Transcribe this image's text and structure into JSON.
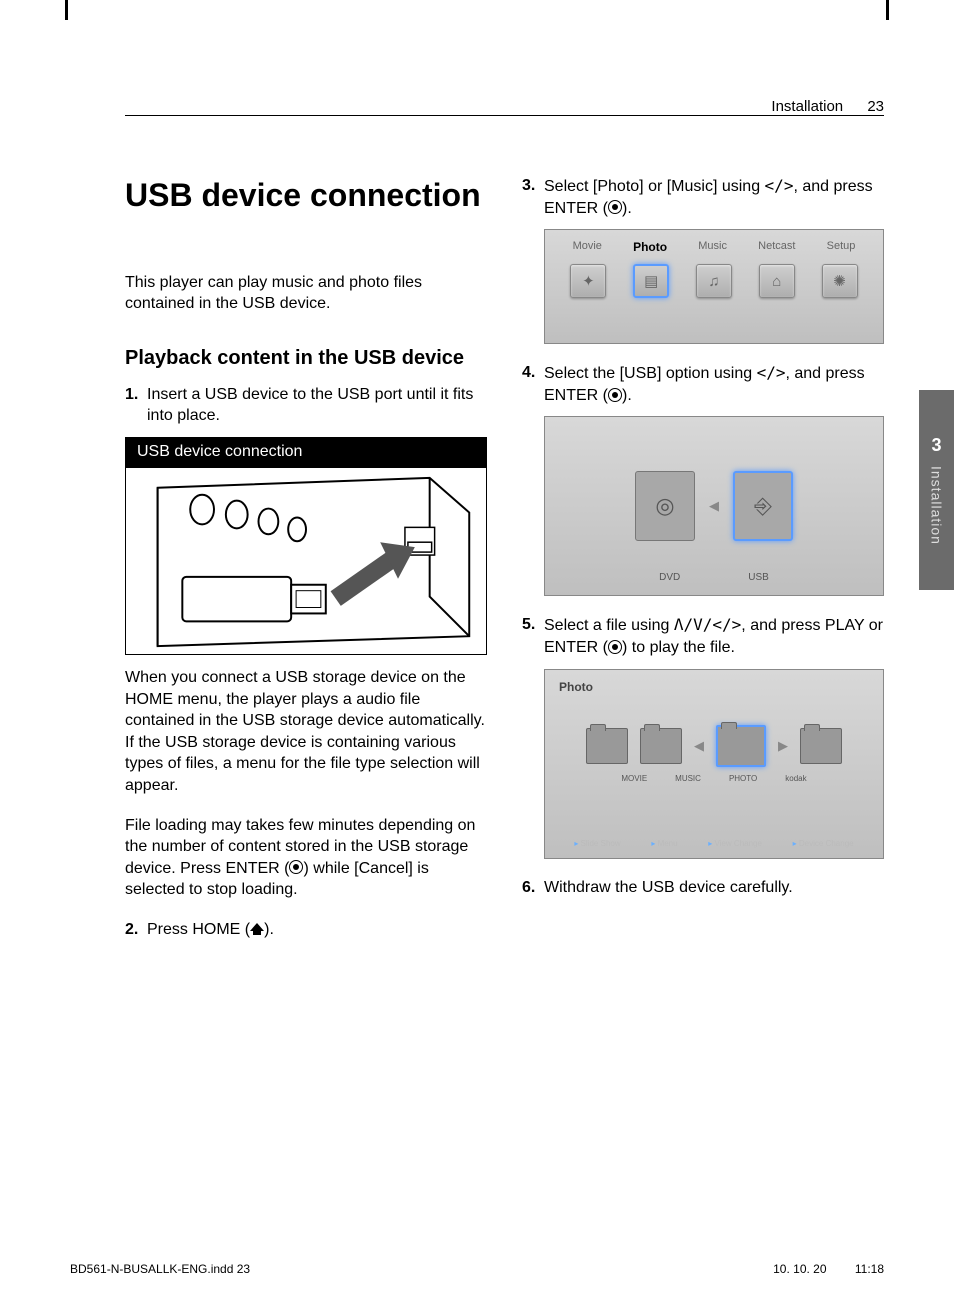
{
  "header": {
    "section": "Installation",
    "page": "23"
  },
  "side": {
    "chapter": "3",
    "label": "Installation"
  },
  "title": "USB device connection",
  "intro": "This player can play music and photo files contained in the USB device.",
  "subheading": "Playback content in the USB device",
  "steps": {
    "s1": {
      "n": "1.",
      "t": "Insert a USB device to the USB port until it fits into place."
    },
    "s2": {
      "n": "2.",
      "pre": "Press HOME (",
      "post": ")."
    },
    "s3": {
      "n": "3.",
      "pre": "Select [Photo] or [Music] using ",
      "nav": "</>",
      "mid": ", and press ENTER (",
      "post": ")."
    },
    "s4": {
      "n": "4.",
      "pre": "Select the [USB] option using ",
      "nav": "</>",
      "mid": ", and press ENTER (",
      "post": ")."
    },
    "s5": {
      "n": "5.",
      "pre": "Select a file using ",
      "nav": "Λ/V/</>",
      "mid": ", and press PLAY or ENTER (",
      "post": ") to play the file."
    },
    "s6": {
      "n": "6.",
      "t": "Withdraw the USB device carefully."
    }
  },
  "diagram_caption": "USB device connection",
  "para1": "When you connect a USB storage device on the HOME menu, the player plays a audio file contained in the USB storage device automatically. If the USB storage device is containing various types of files, a menu for the file type selection will appear.",
  "para2_pre": "File loading may takes few minutes depending on the number of content stored in the USB storage device. Press ENTER (",
  "para2_post": ") while [Cancel] is selected to stop loading.",
  "ss1": {
    "items": [
      "Movie",
      "Photo",
      "Music",
      "Netcast",
      "Setup"
    ],
    "icons": [
      "✦",
      "▤",
      "♫",
      "⌂",
      "✺"
    ]
  },
  "ss2": {
    "left": "DVD",
    "right": "USB"
  },
  "ss3": {
    "title": "Photo",
    "folders": [
      "MOVIE",
      "MUSIC",
      "PHOTO",
      "kodak"
    ],
    "bar": [
      "Slide Show",
      "Menu",
      "View Change",
      "Device Change"
    ]
  },
  "footer": {
    "file": "BD561-N-BUSALLK-ENG.indd   23",
    "date": "10. 10. 20",
    "time": "11:18"
  }
}
